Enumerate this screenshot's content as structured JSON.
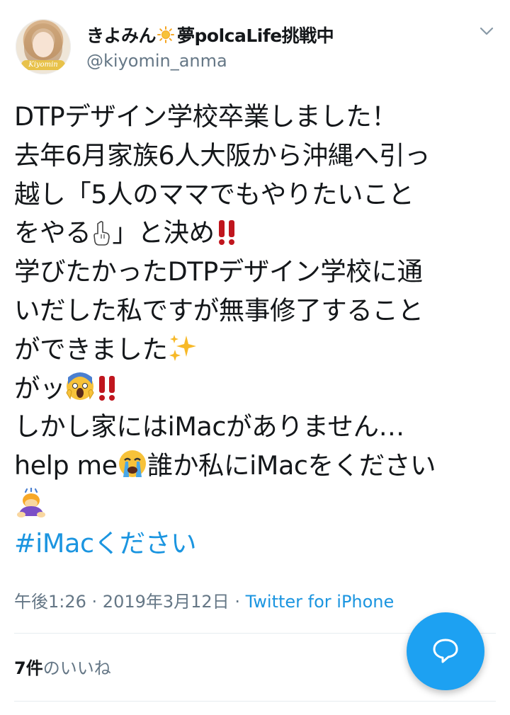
{
  "user": {
    "display_name": "きよみん",
    "display_name_suffix": "夢polcaLife挑戦中",
    "handle": "@kiyomin_anma",
    "avatar_tag": "Kiyomin",
    "sun_icon": "sun-icon"
  },
  "tweet": {
    "lines": [
      "DTPデザイン学校卒業しました！",
      "去年6月家族6人大阪から沖縄へ引っ",
      "越し「5人のママでもやりたいこと",
      "をやる",
      "」と決め",
      "学びたかったDTPデザイン学校に通",
      "いだした私ですが無事修了すること",
      "ができました",
      "がッ",
      "しかし家にはiMacがありません…",
      "help me",
      "誰か私にiMacをください"
    ],
    "hashtag": "#iMacください"
  },
  "meta": {
    "time": "午後1:26",
    "sep1": " · ",
    "date": "2019年3月12日",
    "sep2": " · ",
    "source": "Twitter for iPhone"
  },
  "likes": {
    "count": "7件",
    "label_mid": "の",
    "label": "いいね"
  },
  "colors": {
    "link": "#1b95e0",
    "fab": "#1da1f2",
    "text": "#14171a",
    "secondary": "#657786"
  }
}
